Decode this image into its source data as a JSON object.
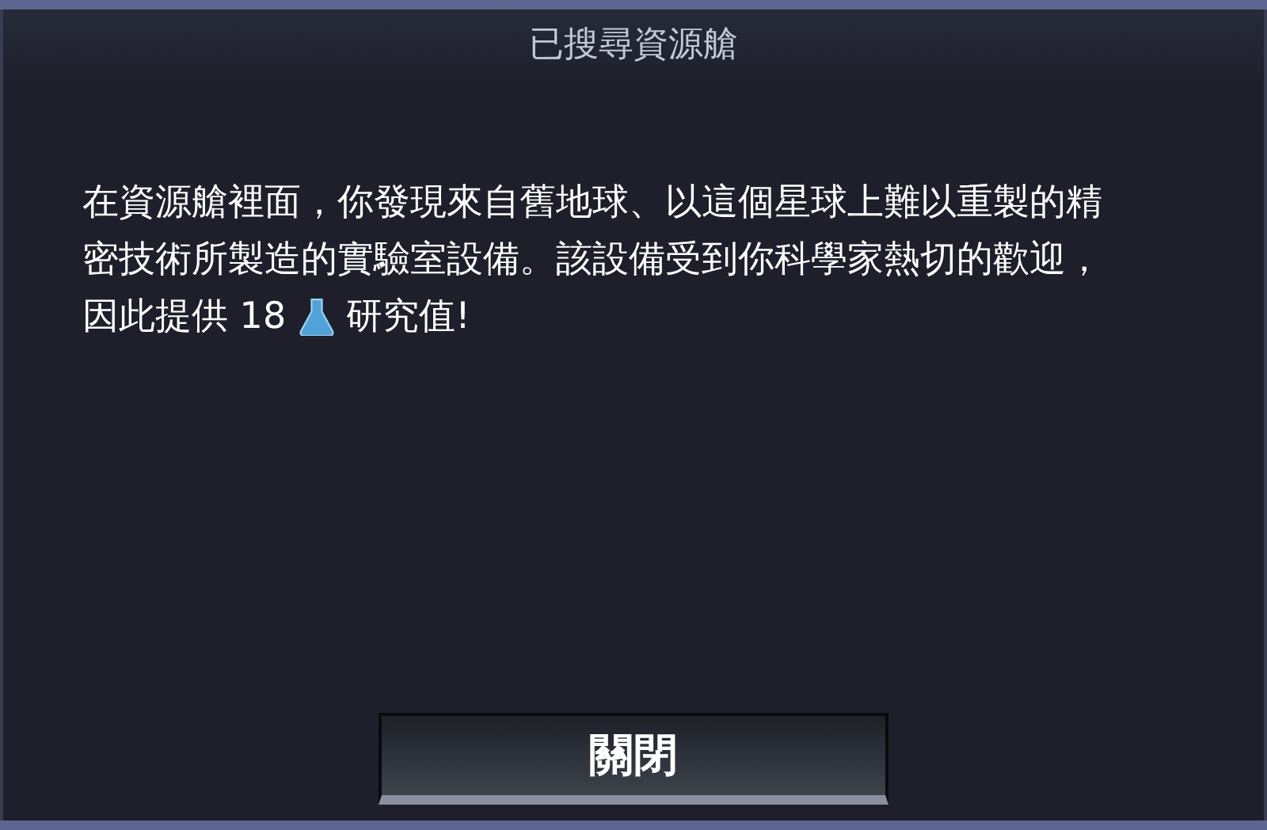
{
  "dialog": {
    "title": "已搜尋資源艙",
    "message_lines": [
      "在資源艙裡面，你發現來自舊地球、以這個星球上難以重製的精",
      "密技術所製造的實驗室設備。該設備受到你科學家熱切的歡迎，"
    ],
    "last_line_before_icon": "因此提供 18",
    "last_line_after_icon": "研究值!",
    "buttons": [
      "關閉"
    ]
  }
}
